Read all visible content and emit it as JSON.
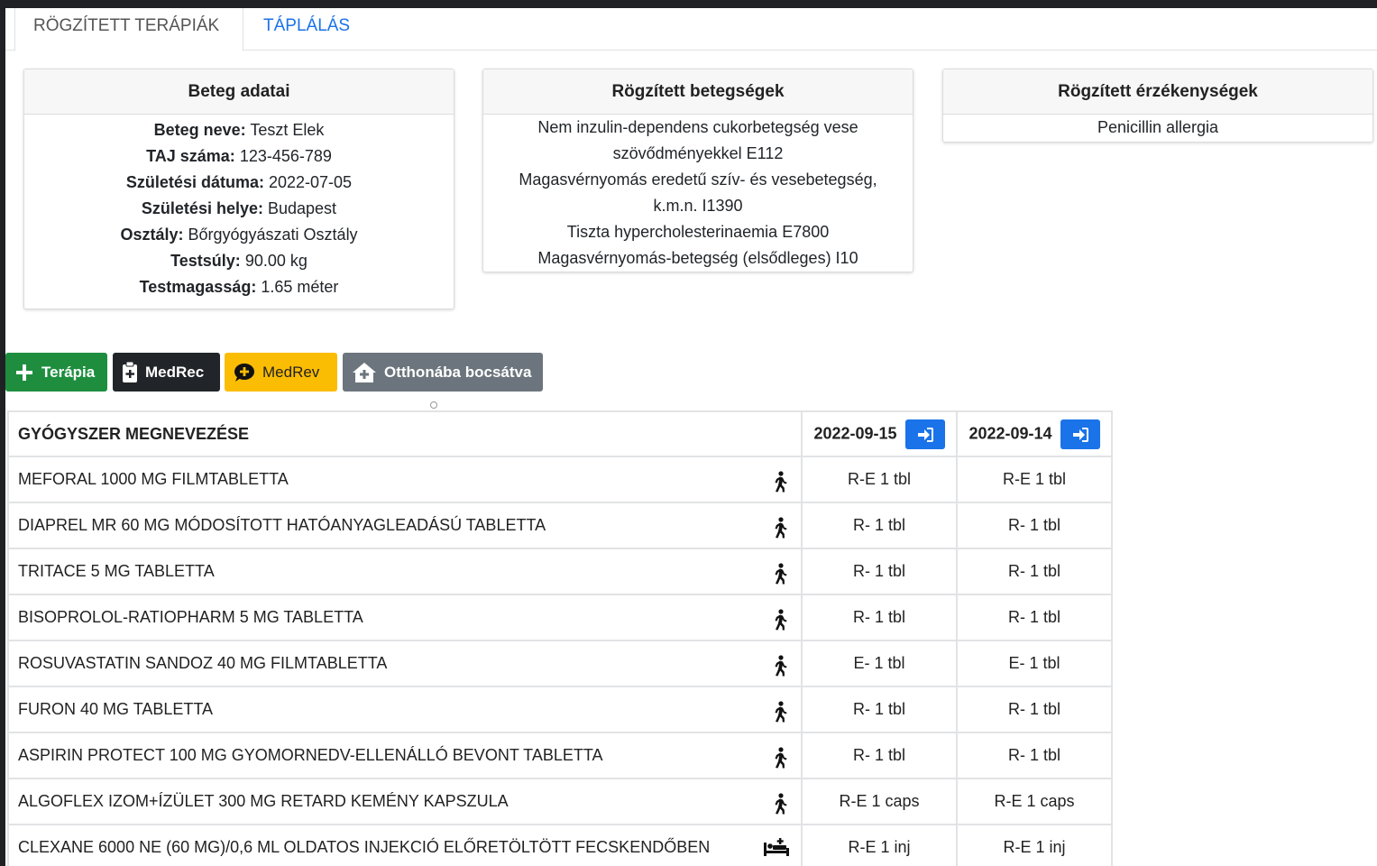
{
  "tabs": [
    {
      "label": "RÖGZÍTETT TERÁPIÁK",
      "active": true
    },
    {
      "label": "TÁPLÁLÁS",
      "active": false
    }
  ],
  "patient": {
    "title": "Beteg adatai",
    "fields": [
      {
        "label": "Beteg neve:",
        "value": "Teszt Elek"
      },
      {
        "label": "TAJ száma:",
        "value": "123-456-789"
      },
      {
        "label": "Születési dátuma:",
        "value": "2022-07-05"
      },
      {
        "label": "Születési helye:",
        "value": "Budapest"
      },
      {
        "label": "Osztály:",
        "value": "Bőrgyógyászati Osztály"
      },
      {
        "label": "Testsúly:",
        "value": "90.00 kg"
      },
      {
        "label": "Testmagasság:",
        "value": "1.65 méter"
      }
    ]
  },
  "diseases": {
    "title": "Rögzített betegségek",
    "lines": [
      "Nem inzulin-dependens cukorbetegség vese",
      "szövődményekkel E112",
      "Magasvérnyomás eredetű szív- és vesebetegség,",
      "k.m.n. I1390",
      "Tiszta hypercholesterinaemia E7800",
      "Magasvérnyomás-betegség (elsődleges) I10"
    ]
  },
  "sensitivities": {
    "title": "Rögzített érzékenységek",
    "items": [
      "Penicillin allergia"
    ]
  },
  "toolbar": {
    "therapy_label": "Terápia",
    "medrec_label": "MedRec",
    "medrev_label": "MedRev",
    "home_label": "Otthonába bocsátva"
  },
  "table": {
    "header": "GYÓGYSZER MEGNEVEZÉSE",
    "dates": [
      "2022-09-15",
      "2022-09-14"
    ],
    "rows": [
      {
        "name": "MEFORAL 1000 MG FILMTABLETTA",
        "icon": "walking-icon",
        "d1": "R-E 1 tbl",
        "d2": "R-E 1 tbl"
      },
      {
        "name": "DIAPREL MR 60 MG MÓDOSÍTOTT HATÓANYAGLEADÁSÚ TABLETTA",
        "icon": "walking-icon",
        "d1": "R- 1 tbl",
        "d2": "R- 1 tbl"
      },
      {
        "name": "TRITACE 5 MG TABLETTA",
        "icon": "walking-icon",
        "d1": "R- 1 tbl",
        "d2": "R- 1 tbl"
      },
      {
        "name": "BISOPROLOL-RATIOPHARM 5 MG TABLETTA",
        "icon": "walking-icon",
        "d1": "R- 1 tbl",
        "d2": "R- 1 tbl"
      },
      {
        "name": "ROSUVASTATIN SANDOZ 40 MG FILMTABLETTA",
        "icon": "walking-icon",
        "d1": "E- 1 tbl",
        "d2": "E- 1 tbl"
      },
      {
        "name": "FURON 40 MG TABLETTA",
        "icon": "walking-icon",
        "d1": "R- 1 tbl",
        "d2": "R- 1 tbl"
      },
      {
        "name": "ASPIRIN PROTECT 100 MG GYOMORNEDV-ELLENÁLLÓ BEVONT TABLETTA",
        "icon": "walking-icon",
        "d1": "R- 1 tbl",
        "d2": "R- 1 tbl"
      },
      {
        "name": "ALGOFLEX IZOM+ÍZÜLET 300 MG RETARD KEMÉNY KAPSZULA",
        "icon": "walking-icon",
        "d1": "R-E 1 caps",
        "d2": "R-E 1 caps"
      },
      {
        "name": "CLEXANE 6000 NE (60 MG)/0,6 ML OLDATOS INJEKCIÓ ELŐRETÖLTÖTT FECSKENDŐBEN",
        "icon": "bed-icon",
        "d1": "R-E 1 inj",
        "d2": "R-E 1 inj"
      }
    ]
  }
}
